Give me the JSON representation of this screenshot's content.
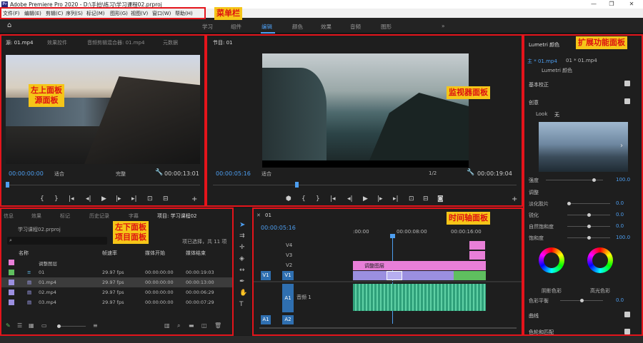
{
  "window": {
    "title": "Adobe Premiere Pro 2020 - D:\\手拍\\练习\\学习课程02.prproj",
    "logo": "Pr",
    "min": "—",
    "max": "❐",
    "close": "✕"
  },
  "menu": [
    "文件(F)",
    "编辑(E)",
    "剪辑(C)",
    "序列(S)",
    "标记(M)",
    "图形(G)",
    "视图(V)",
    "窗口(W)",
    "帮助(H)"
  ],
  "workspaces": [
    "学习",
    "组件",
    "编辑",
    "颜色",
    "效果",
    "音频",
    "图形"
  ],
  "workspace_more": "»",
  "annotations": {
    "menubar": "菜单栏",
    "ext_panel": "扩展功能面板",
    "top_left_1": "左上面板",
    "top_left_2": "源面板",
    "monitor": "监视器面板",
    "bottom_left_1": "左下面板",
    "bottom_left_2": "项目面板",
    "timeline": "时间轴面板"
  },
  "source": {
    "tabs": [
      "源: 01.mp4",
      "效果控件",
      "音频剪辑混合器: 01.mp4",
      "元数据"
    ],
    "timecode_in": "00:00:00:00",
    "fit": "适合",
    "quality": "完整",
    "timecode_dur": "00:00:13:01"
  },
  "program": {
    "tab": "节目: 01",
    "timecode_in": "00:00:05:16",
    "fit": "适合",
    "ratio": "1/2",
    "timecode_dur": "00:00:19:04"
  },
  "project": {
    "tabs": [
      "信息",
      "效果",
      "标记",
      "历史记录",
      "字幕",
      "项目: 学习课程02"
    ],
    "file": "学习课程02.prproj",
    "selection": "项已选择，共 11 项",
    "columns": [
      "名称",
      "帧速率",
      "媒体开始",
      "媒体结束"
    ],
    "rows": [
      {
        "name": "调整图层",
        "fps": "",
        "start": "",
        "end": "",
        "color": "#e87fd8"
      },
      {
        "name": "01",
        "fps": "29.97 fps",
        "start": "00:00:00:00",
        "end": "00:00:19:03",
        "color": "#5fbf5f"
      },
      {
        "name": "01.mp4",
        "fps": "29.97 fps",
        "start": "00:00:00:00",
        "end": "00:00:13:00",
        "color": "#9b8fe0"
      },
      {
        "name": "02.mp4",
        "fps": "29.97 fps",
        "start": "00:00:00:00",
        "end": "00:00:06:29",
        "color": "#9b8fe0"
      },
      {
        "name": "03.mp4",
        "fps": "29.97 fps",
        "start": "00:00:00:00",
        "end": "00:00:07:29",
        "color": "#9b8fe0"
      }
    ]
  },
  "timeline": {
    "tab": "01",
    "timecode": "00:00:05:16",
    "ruler": [
      ":00:00",
      "00:00:08:00",
      "00:00:16:00"
    ],
    "video_tracks": [
      "V4",
      "V3",
      "V2",
      "V1"
    ],
    "audio_tracks": [
      "A1",
      "A2"
    ],
    "audio_name": "音频 1",
    "adjust_clip": "调整图层",
    "src_v": "V1",
    "src_a": "A1"
  },
  "lumetri": {
    "tab": "Lumetri 颜色",
    "clip_main": "主 * 01.mp4",
    "clip_seq": "01 * 01.mp4",
    "effect": "Lumetri 颜色",
    "basic": "基本校正",
    "creative": "创意",
    "look_label": "Look",
    "look_value": "无",
    "intensity": "强度",
    "intensity_val": "100.0",
    "adjust": "调整",
    "faded": "淡化胶片",
    "faded_val": "0.0",
    "sharpen": "锐化",
    "sharpen_val": "0.0",
    "vibrance": "自然饱和度",
    "vibrance_val": "0.0",
    "saturation": "饱和度",
    "saturation_val": "100.0",
    "shadow": "阴影色彩",
    "highlight": "高光色彩",
    "tint": "色彩平衡",
    "tint_val": "0.0",
    "curves": "曲线",
    "wheels": "色轮和匹配"
  }
}
